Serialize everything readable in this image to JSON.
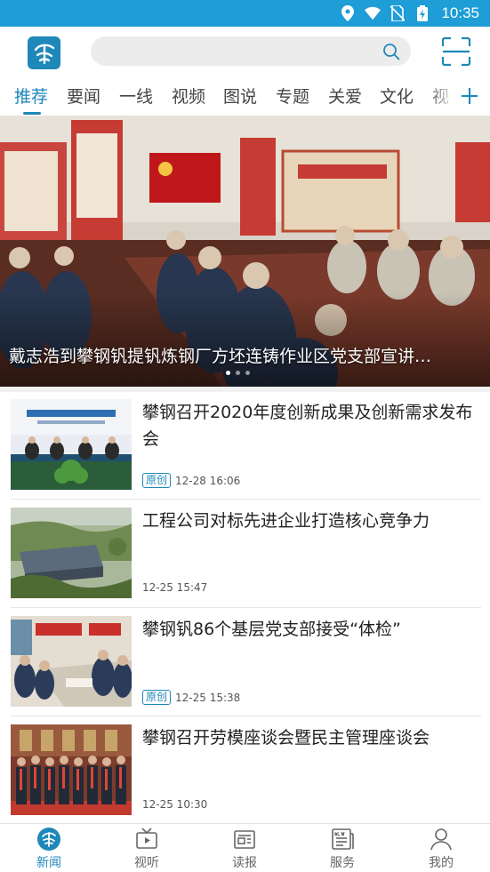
{
  "status_bar": {
    "time": "10:35"
  },
  "header": {
    "search_placeholder": ""
  },
  "channels": [
    "推荐",
    "要闻",
    "一线",
    "视频",
    "图说",
    "专题",
    "关爱",
    "文化",
    "视"
  ],
  "active_channel": "推荐",
  "banner": {
    "caption": "戴志浩到攀钢钒提钒炼钢厂方坯连铸作业区党支部宣讲…",
    "dots": 3,
    "active_dot": 1
  },
  "news": [
    {
      "title": "攀钢召开2020年度创新成果及创新需求发布会",
      "tag": "原创",
      "time": "12-28 16:06"
    },
    {
      "title": "工程公司对标先进企业打造核心竞争力",
      "tag": "",
      "time": "12-25 15:47"
    },
    {
      "title": "攀钢钒86个基层党支部接受“体检”",
      "tag": "原创",
      "time": "12-25 15:38"
    },
    {
      "title": "攀钢召开劳模座谈会暨民主管理座谈会",
      "tag": "",
      "time": "12-25 10:30"
    }
  ],
  "bottom_nav": [
    {
      "label": "新闻",
      "icon": "news-logo-icon",
      "active": true
    },
    {
      "label": "视听",
      "icon": "tv-icon",
      "active": false
    },
    {
      "label": "读报",
      "icon": "newspaper-icon",
      "active": false
    },
    {
      "label": "服务",
      "icon": "service-news-icon",
      "active": false
    },
    {
      "label": "我的",
      "icon": "user-icon",
      "active": false
    }
  ],
  "colors": {
    "accent": "#1e88b9",
    "status_bar": "#1e9dd6"
  }
}
